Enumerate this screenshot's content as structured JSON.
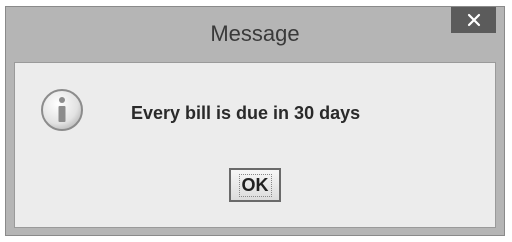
{
  "dialog": {
    "title": "Message",
    "close_icon": "close-icon",
    "info_icon": "information-icon",
    "message": "Every bill is due in 30 days",
    "ok_label": "OK"
  },
  "colors": {
    "frame": "#b5b5b5",
    "close_button": "#5b5b5b",
    "content_bg": "#ececec"
  }
}
